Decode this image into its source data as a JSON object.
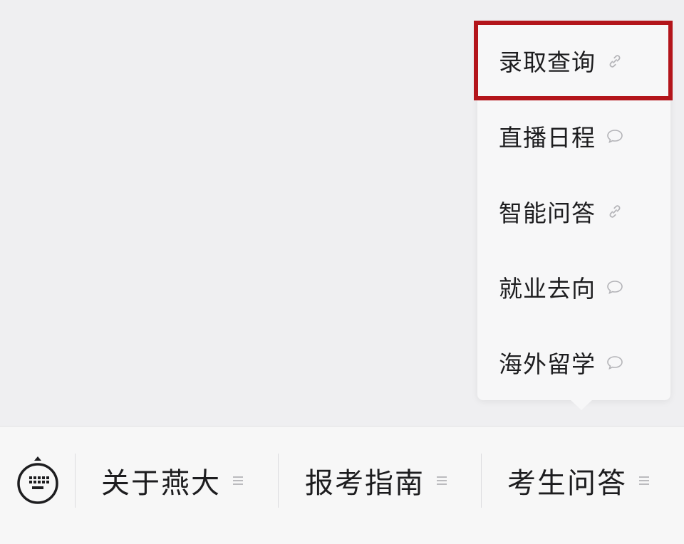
{
  "popup_menu": {
    "items": [
      {
        "label": "录取查询",
        "icon": "link-icon",
        "highlighted": true
      },
      {
        "label": "直播日程",
        "icon": "message-bubble-icon",
        "highlighted": false
      },
      {
        "label": "智能问答",
        "icon": "link-icon",
        "highlighted": false
      },
      {
        "label": "就业去向",
        "icon": "message-bubble-icon",
        "highlighted": false
      },
      {
        "label": "海外留学",
        "icon": "message-bubble-icon",
        "highlighted": false
      }
    ]
  },
  "bottom_bar": {
    "keyboard_icon": "keyboard-icon",
    "tabs": [
      {
        "label": "关于燕大",
        "icon": "menu-lines-icon"
      },
      {
        "label": "报考指南",
        "icon": "menu-lines-icon"
      },
      {
        "label": "考生问答",
        "icon": "menu-lines-icon"
      }
    ]
  },
  "colors": {
    "background": "#efeff1",
    "popup_background": "#f7f7f8",
    "highlight_border": "#b3151b",
    "text": "#1d1d1f",
    "icon_gray": "#b4b4b8"
  }
}
